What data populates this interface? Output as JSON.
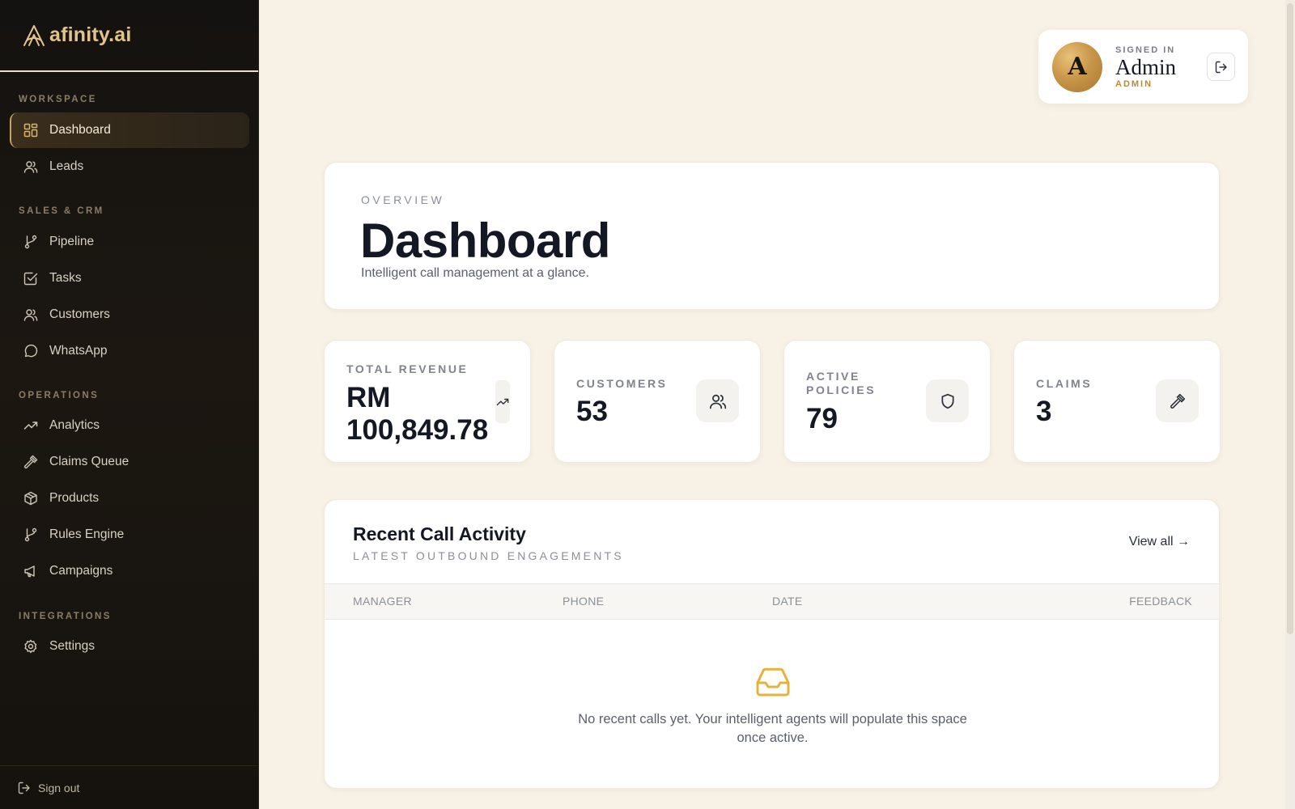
{
  "app": {
    "brand": "afinity.ai"
  },
  "sidebar": {
    "sections": {
      "workspace": "WORKSPACE",
      "sales": "SALES & CRM",
      "operations": "OPERATIONS",
      "integrations": "INTEGRATIONS"
    },
    "items": {
      "dashboard": "Dashboard",
      "leads": "Leads",
      "pipeline": "Pipeline",
      "tasks": "Tasks",
      "customers": "Customers",
      "whatsapp": "WhatsApp",
      "analytics": "Analytics",
      "claims_queue": "Claims Queue",
      "products": "Products",
      "rules_engine": "Rules Engine",
      "campaigns": "Campaigns",
      "settings": "Settings"
    },
    "active_item": "Dashboard",
    "sign_out": "Sign out"
  },
  "user": {
    "initial": "A",
    "signed_in_label": "SIGNED IN",
    "name": "Admin",
    "role": "ADMIN"
  },
  "hero": {
    "eyebrow": "OVERVIEW",
    "title": "Dashboard",
    "subtitle": "Intelligent call management at a glance."
  },
  "stats": {
    "revenue": {
      "label": "TOTAL REVENUE",
      "value_line1": "RM",
      "value_line2": "100,849.78",
      "icon": "trending-up-icon"
    },
    "customers": {
      "label": "CUSTOMERS",
      "value": "53",
      "icon": "users-icon"
    },
    "policies": {
      "label_line1": "ACTIVE",
      "label_line2": "POLICIES",
      "value": "79",
      "icon": "shield-icon"
    },
    "claims": {
      "label": "CLAIMS",
      "value": "3",
      "icon": "gavel-icon"
    }
  },
  "activity": {
    "title": "Recent Call Activity",
    "subtitle": "LATEST OUTBOUND ENGAGEMENTS",
    "view_all": "View all →",
    "columns": [
      "MANAGER",
      "PHONE",
      "DATE",
      "FEEDBACK"
    ],
    "rows": [],
    "empty_text": "No recent calls yet. Your intelligent agents will populate this space once active."
  },
  "colors": {
    "accent_gold": "#c9a45c",
    "sidebar_bg": "#141210",
    "page_bg": "#f7f1e6",
    "text_dark": "#141824"
  }
}
